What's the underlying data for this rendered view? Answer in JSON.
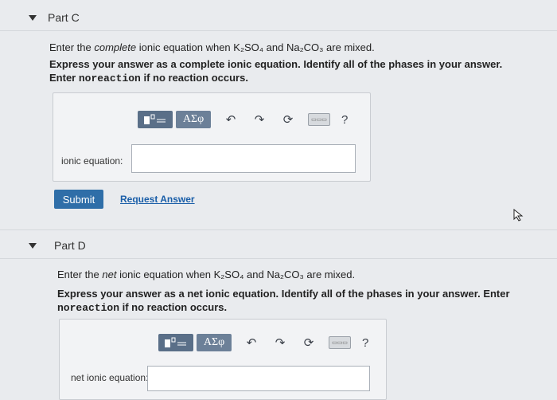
{
  "partC": {
    "title": "Part C",
    "prompt_pre": "Enter the ",
    "prompt_em": "complete",
    "prompt_post": " ionic equation when K₂SO₄ and Na₂CO₃ are mixed.",
    "instruction": "Express your answer as a complete ionic equation. Identify all of the phases in your answer. Enter ",
    "instruction_code": "noreaction",
    "instruction_tail": " if no reaction occurs.",
    "toolbar": {
      "greek": "ΑΣφ",
      "help": "?"
    },
    "field_label": "ionic equation:",
    "field_value": "",
    "submit": "Submit",
    "request": "Request Answer"
  },
  "partD": {
    "title": "Part D",
    "prompt_pre": "Enter the ",
    "prompt_em": "net",
    "prompt_post": " ionic equation when K₂SO₄ and Na₂CO₃ are mixed.",
    "instruction": "Express your answer as a net ionic equation. Identify all of the phases in your answer. Enter ",
    "instruction_code": "noreaction",
    "instruction_tail": " if no reaction occurs.",
    "toolbar": {
      "greek": "ΑΣφ",
      "help": "?"
    },
    "field_label": "net ionic equation:",
    "field_value": ""
  }
}
